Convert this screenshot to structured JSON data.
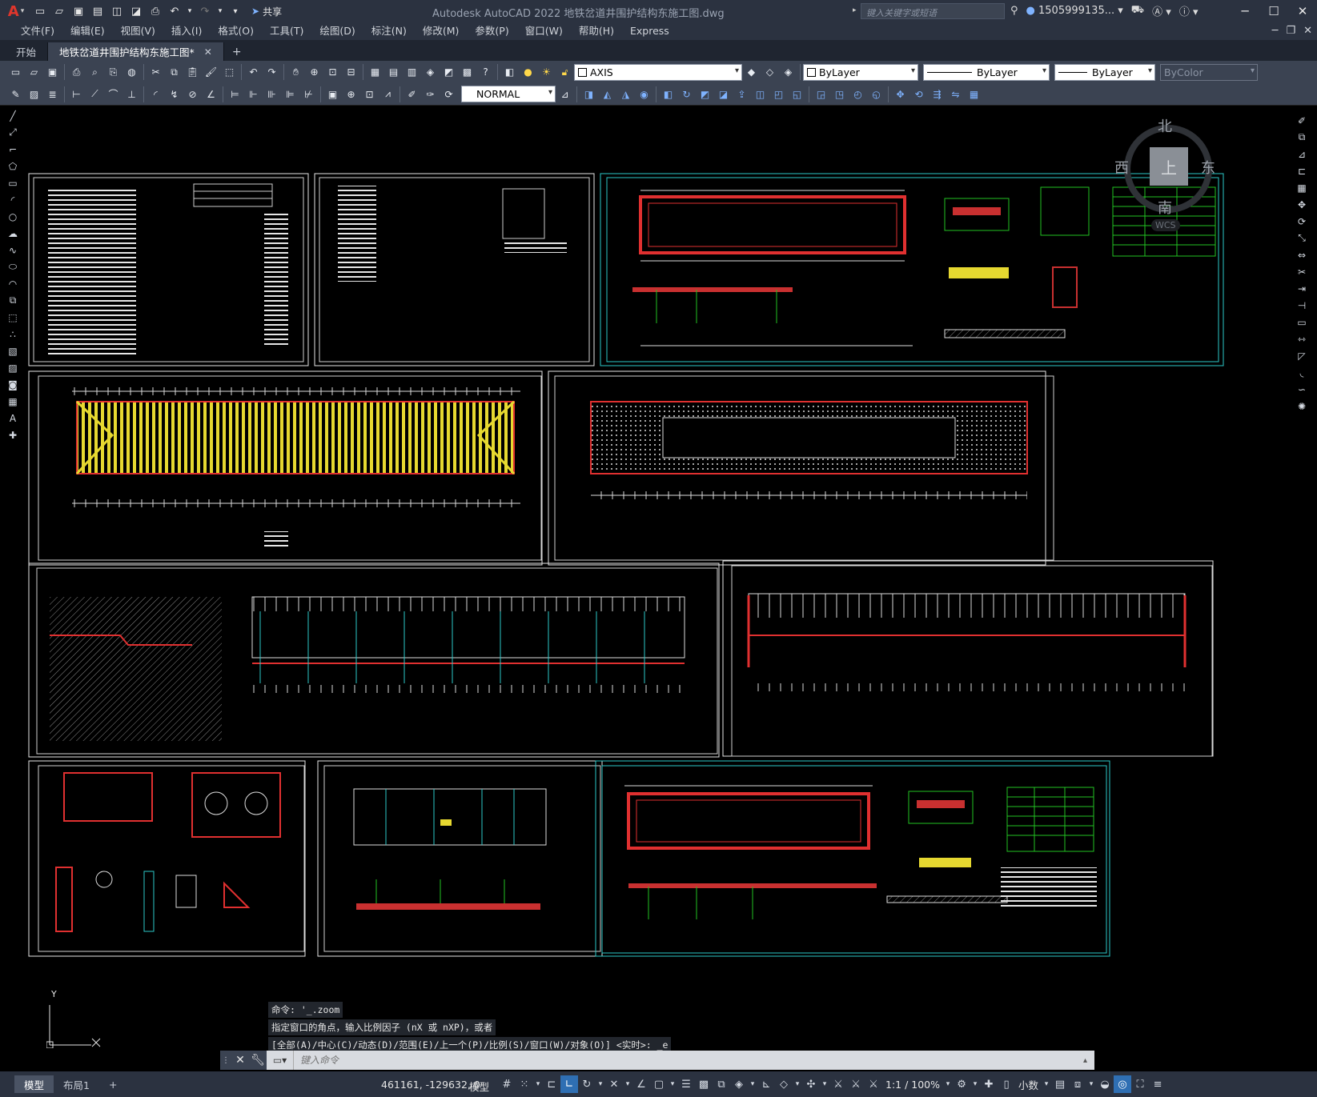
{
  "app": {
    "logo": "A",
    "window_title": "Autodesk AutoCAD 2022    地铁岔道井围护结构东施工图.dwg",
    "share_label": "共享",
    "search_placeholder": "键入关键字或短语",
    "user": "1505999135...",
    "accent_color": "#e0362c"
  },
  "menu": [
    "文件(F)",
    "编辑(E)",
    "视图(V)",
    "插入(I)",
    "格式(O)",
    "工具(T)",
    "绘图(D)",
    "标注(N)",
    "修改(M)",
    "参数(P)",
    "窗口(W)",
    "帮助(H)",
    "Express"
  ],
  "tabs": [
    {
      "label": "开始",
      "active": false
    },
    {
      "label": "地铁岔道井围护结构东施工图*",
      "active": true
    }
  ],
  "toolbar": {
    "layer": "AXIS",
    "color": "ByLayer",
    "linetype": "ByLayer",
    "lineweight": "ByLayer",
    "plotstyle": "ByColor",
    "dimstyle": "NORMAL"
  },
  "viewcube": {
    "north": "北",
    "south": "南",
    "east": "东",
    "west": "西",
    "top": "上",
    "wcs": "WCS"
  },
  "ucs": {
    "y_label": "Y"
  },
  "command": {
    "history": [
      "命令: '_.zoom",
      "指定窗口的角点，输入比例因子 (nX 或 nXP)，或者",
      "[全部(A)/中心(C)/动态(D)/范围(E)/上一个(P)/比例(S)/窗口(W)/对象(O)] <实时>: _e"
    ],
    "placeholder": "键入命令"
  },
  "layouts": [
    {
      "label": "模型",
      "active": true
    },
    {
      "label": "布局1",
      "active": false
    }
  ],
  "status": {
    "coords": "461161, -129632, 0",
    "model": "模型",
    "scale": "1:1 / 100%",
    "units": "小数"
  }
}
